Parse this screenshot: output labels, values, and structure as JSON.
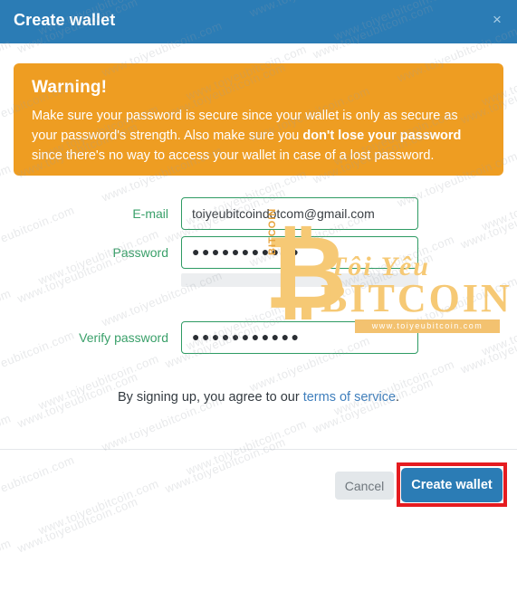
{
  "header": {
    "title": "Create wallet",
    "close_label": "×",
    "bg_color": "#2b7cb5"
  },
  "warning": {
    "title": "Warning!",
    "body_part1": "Make sure your password is secure since your wallet is only as secure as your password's strength. Also make sure you ",
    "body_strong": "don't lose your password",
    "body_part2": " since there's no way to access your wallet in case of a lost password.",
    "bg_color": "#ee9d22"
  },
  "form": {
    "email": {
      "label": "E-mail",
      "value": "toiyeubitcoindotcom@gmail.com",
      "placeholder": "E-mail"
    },
    "password": {
      "label": "Password",
      "value": "●●●●●●●●●●●",
      "placeholder": "Password"
    },
    "verify_password": {
      "label": "Verify password",
      "value": "●●●●●●●●●●●",
      "placeholder": "Verify password"
    },
    "label_color": "#3aa06a",
    "border_color": "#2e9b63"
  },
  "terms": {
    "prefix": "By signing up, you agree to our ",
    "link": "terms of service",
    "suffix": "."
  },
  "footer": {
    "cancel_label": "Cancel",
    "create_label": "Create wallet",
    "highlight_color": "#e51b20"
  },
  "watermark": {
    "text": "www.toiyeubitcoin.com",
    "logo_line1": "Tôi Yêu",
    "logo_line2": "BITCOIN",
    "logo_symbol": "₿",
    "logo_vertical": "BITCOIN",
    "logo_url": "www.toiyeubitcoin.com",
    "color": "#f6c975"
  }
}
